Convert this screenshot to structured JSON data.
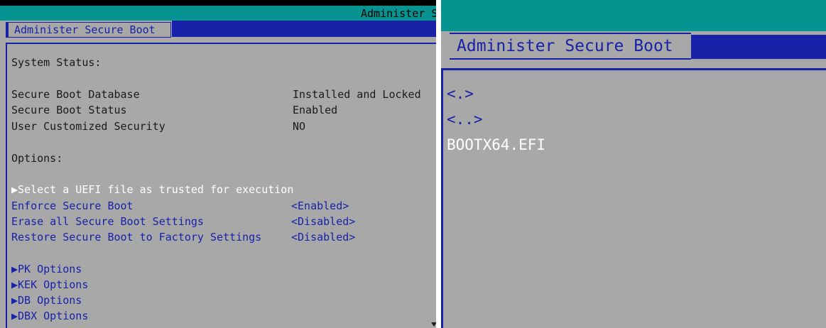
{
  "left": {
    "window_title": "Administer S",
    "tab_label": "Administer Secure Boot",
    "system_status_heading": "System Status:",
    "status_rows": [
      {
        "label": "Secure Boot Database",
        "value": "Installed and Locked"
      },
      {
        "label": "Secure Boot Status",
        "value": "Enabled"
      },
      {
        "label": "User Customized Security",
        "value": "NO"
      }
    ],
    "options_heading": "Options:",
    "select_uefi_label": "Select a UEFI file as trusted for execution",
    "settings": [
      {
        "label": "Enforce Secure Boot",
        "value": "<Enabled>"
      },
      {
        "label": "Erase all Secure Boot Settings",
        "value": "<Disabled>"
      },
      {
        "label": "Restore Secure Boot to Factory Settings",
        "value": "<Disabled>"
      }
    ],
    "submenus": [
      "PK Options",
      "KEK Options",
      "DB Options",
      "DBX Options"
    ]
  },
  "right": {
    "tab_label": "Administer Secure Boot",
    "file_items": [
      "<.>",
      "<..>",
      "BOOTX64.EFI"
    ]
  },
  "colors": {
    "bios_gray": "#a8a8a8",
    "bios_blue": "#1822a8",
    "bios_teal": "#07938f",
    "highlight_white": "#ffffff"
  },
  "icons": {
    "submenu_arrow": "right-triangle-icon",
    "mouse_cursor": "mouse-pointer-icon"
  }
}
